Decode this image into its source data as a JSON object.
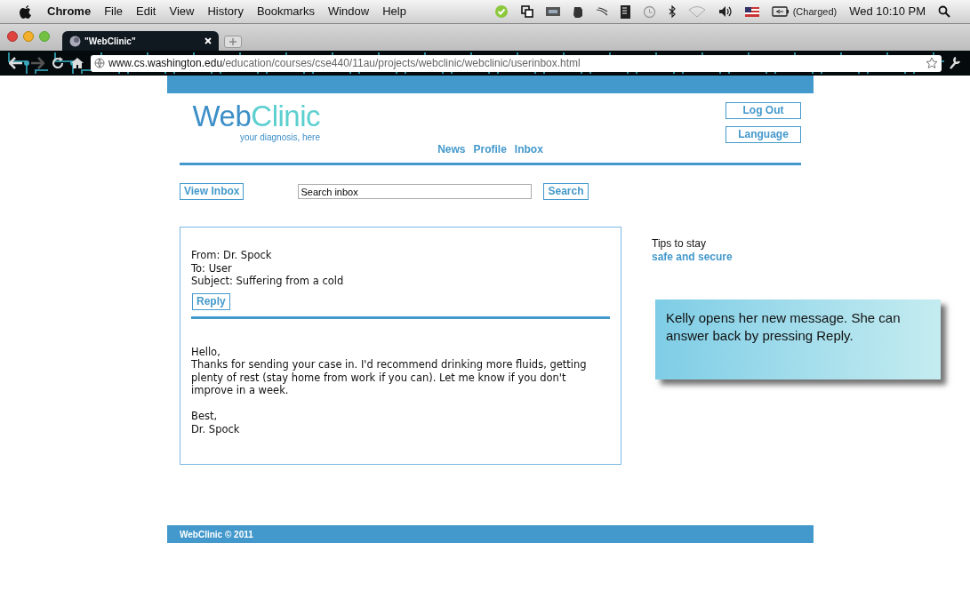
{
  "menu_bar": {
    "app": "Chrome",
    "items": [
      "File",
      "Edit",
      "View",
      "History",
      "Bookmarks",
      "Window",
      "Help"
    ],
    "battery": "(Charged)",
    "clock": "Wed 10:10 PM"
  },
  "browser": {
    "tab_title": "\"WebClinic\"",
    "url_host": "www.cs.washington.edu",
    "url_path": "/education/courses/cse440/11au/projects/webclinic/webclinic/userinbox.html"
  },
  "site": {
    "logo_first": "Web",
    "logo_second": "Clinic",
    "tagline": "your diagnosis, here",
    "header_buttons": [
      "Log Out",
      "Language"
    ],
    "nav": [
      {
        "label": "News"
      },
      {
        "label": "Profile"
      },
      {
        "label": "Inbox"
      }
    ],
    "view_inbox": "View Inbox",
    "search": {
      "value": "Search inbox"
    },
    "search_button": "Search",
    "message": {
      "from": "From: Dr. Spock",
      "to": "To: User",
      "subject": "Subject: Suffering from a cold",
      "reply": "Reply",
      "body": [
        "Hello,",
        "Thanks for sending your case in. I'd recommend drinking more fluids, getting plenty of rest (stay home from work if you can). Let me know if you don't improve in a week."
      ],
      "closing": [
        "Best,",
        "Dr. Spock"
      ]
    },
    "tips": {
      "text": "Tips to stay",
      "link": "safe and secure"
    },
    "footer": "WebClinic © 2011"
  },
  "callout": "Kelly opens her new message. She can answer back by pressing Reply."
}
